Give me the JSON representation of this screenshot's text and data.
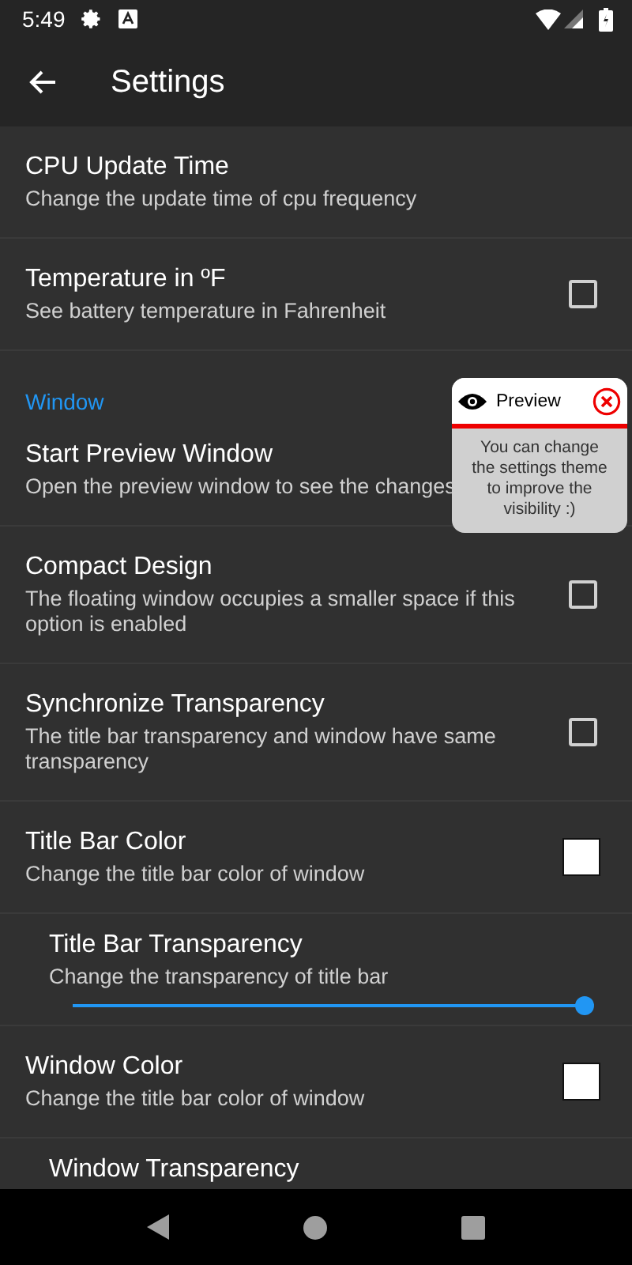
{
  "status_bar": {
    "time": "5:49"
  },
  "app_bar": {
    "title": "Settings"
  },
  "items": [
    {
      "kind": "text",
      "title": "CPU Update Time",
      "summary": "Change the update time of cpu frequency"
    },
    {
      "kind": "checkbox",
      "title": "Temperature in ºF",
      "summary": "See battery temperature in Fahrenheit",
      "checked": false
    },
    {
      "kind": "header",
      "title": "Window"
    },
    {
      "kind": "text",
      "title": "Start Preview Window",
      "summary": "Open the preview window to see the changes"
    },
    {
      "kind": "checkbox",
      "title": "Compact Design",
      "summary": "The floating window occupies a smaller space if this option is enabled",
      "checked": false
    },
    {
      "kind": "checkbox",
      "title": "Synchronize Transparency",
      "summary": "The title bar transparency and window have same transparency",
      "checked": false
    },
    {
      "kind": "color",
      "title": "Title Bar Color",
      "summary": "Change the title bar color of window",
      "color": "#ffffff"
    },
    {
      "kind": "slider",
      "title": "Title Bar Transparency",
      "summary": "Change the transparency of title bar",
      "level": 1
    },
    {
      "kind": "color",
      "title": "Window Color",
      "summary": "Change the title bar color of window",
      "color": "#ffffff"
    },
    {
      "kind": "slider",
      "title": "Window Transparency"
    }
  ],
  "preview_popup": {
    "title": "Preview",
    "message": "You can change the settings theme to improve the visibility :)"
  }
}
